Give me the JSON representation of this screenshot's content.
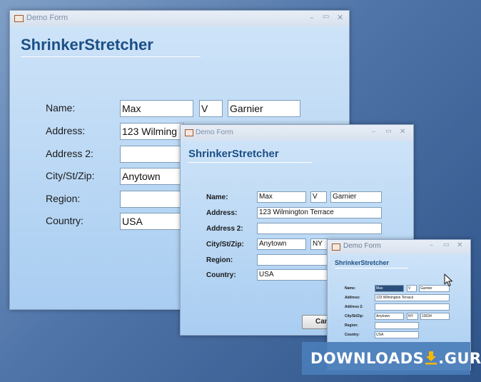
{
  "window_title": "Demo Form",
  "form_title": "ShrinkerStretcher",
  "labels": {
    "name": "Name:",
    "address": "Address:",
    "address2": "Address 2:",
    "city_st_zip": "City/St/Zip:",
    "region": "Region:",
    "country": "Country:"
  },
  "values": {
    "first_name": "Max",
    "middle_initial": "V",
    "last_name": "Garnier",
    "address": "123 Wilmington Terrace",
    "address_truncated": "123 Wilming",
    "address2": "",
    "city": "Anytown",
    "state": "NY",
    "zip": "10034",
    "region": "",
    "country": "USA"
  },
  "buttons": {
    "cancel_visible": "Canc"
  },
  "controls": {
    "minimize": "–",
    "maximize": "▭",
    "close": "✕"
  },
  "watermark": {
    "left": "DOWNLOADS",
    "right": ".GURU"
  },
  "colors": {
    "form_title": "#1c4f85",
    "client_top": "#cde3f8",
    "client_bottom": "#a9cdf1",
    "watermark_bg": "#4a7db8",
    "watermark_icon": "#f5b800"
  }
}
